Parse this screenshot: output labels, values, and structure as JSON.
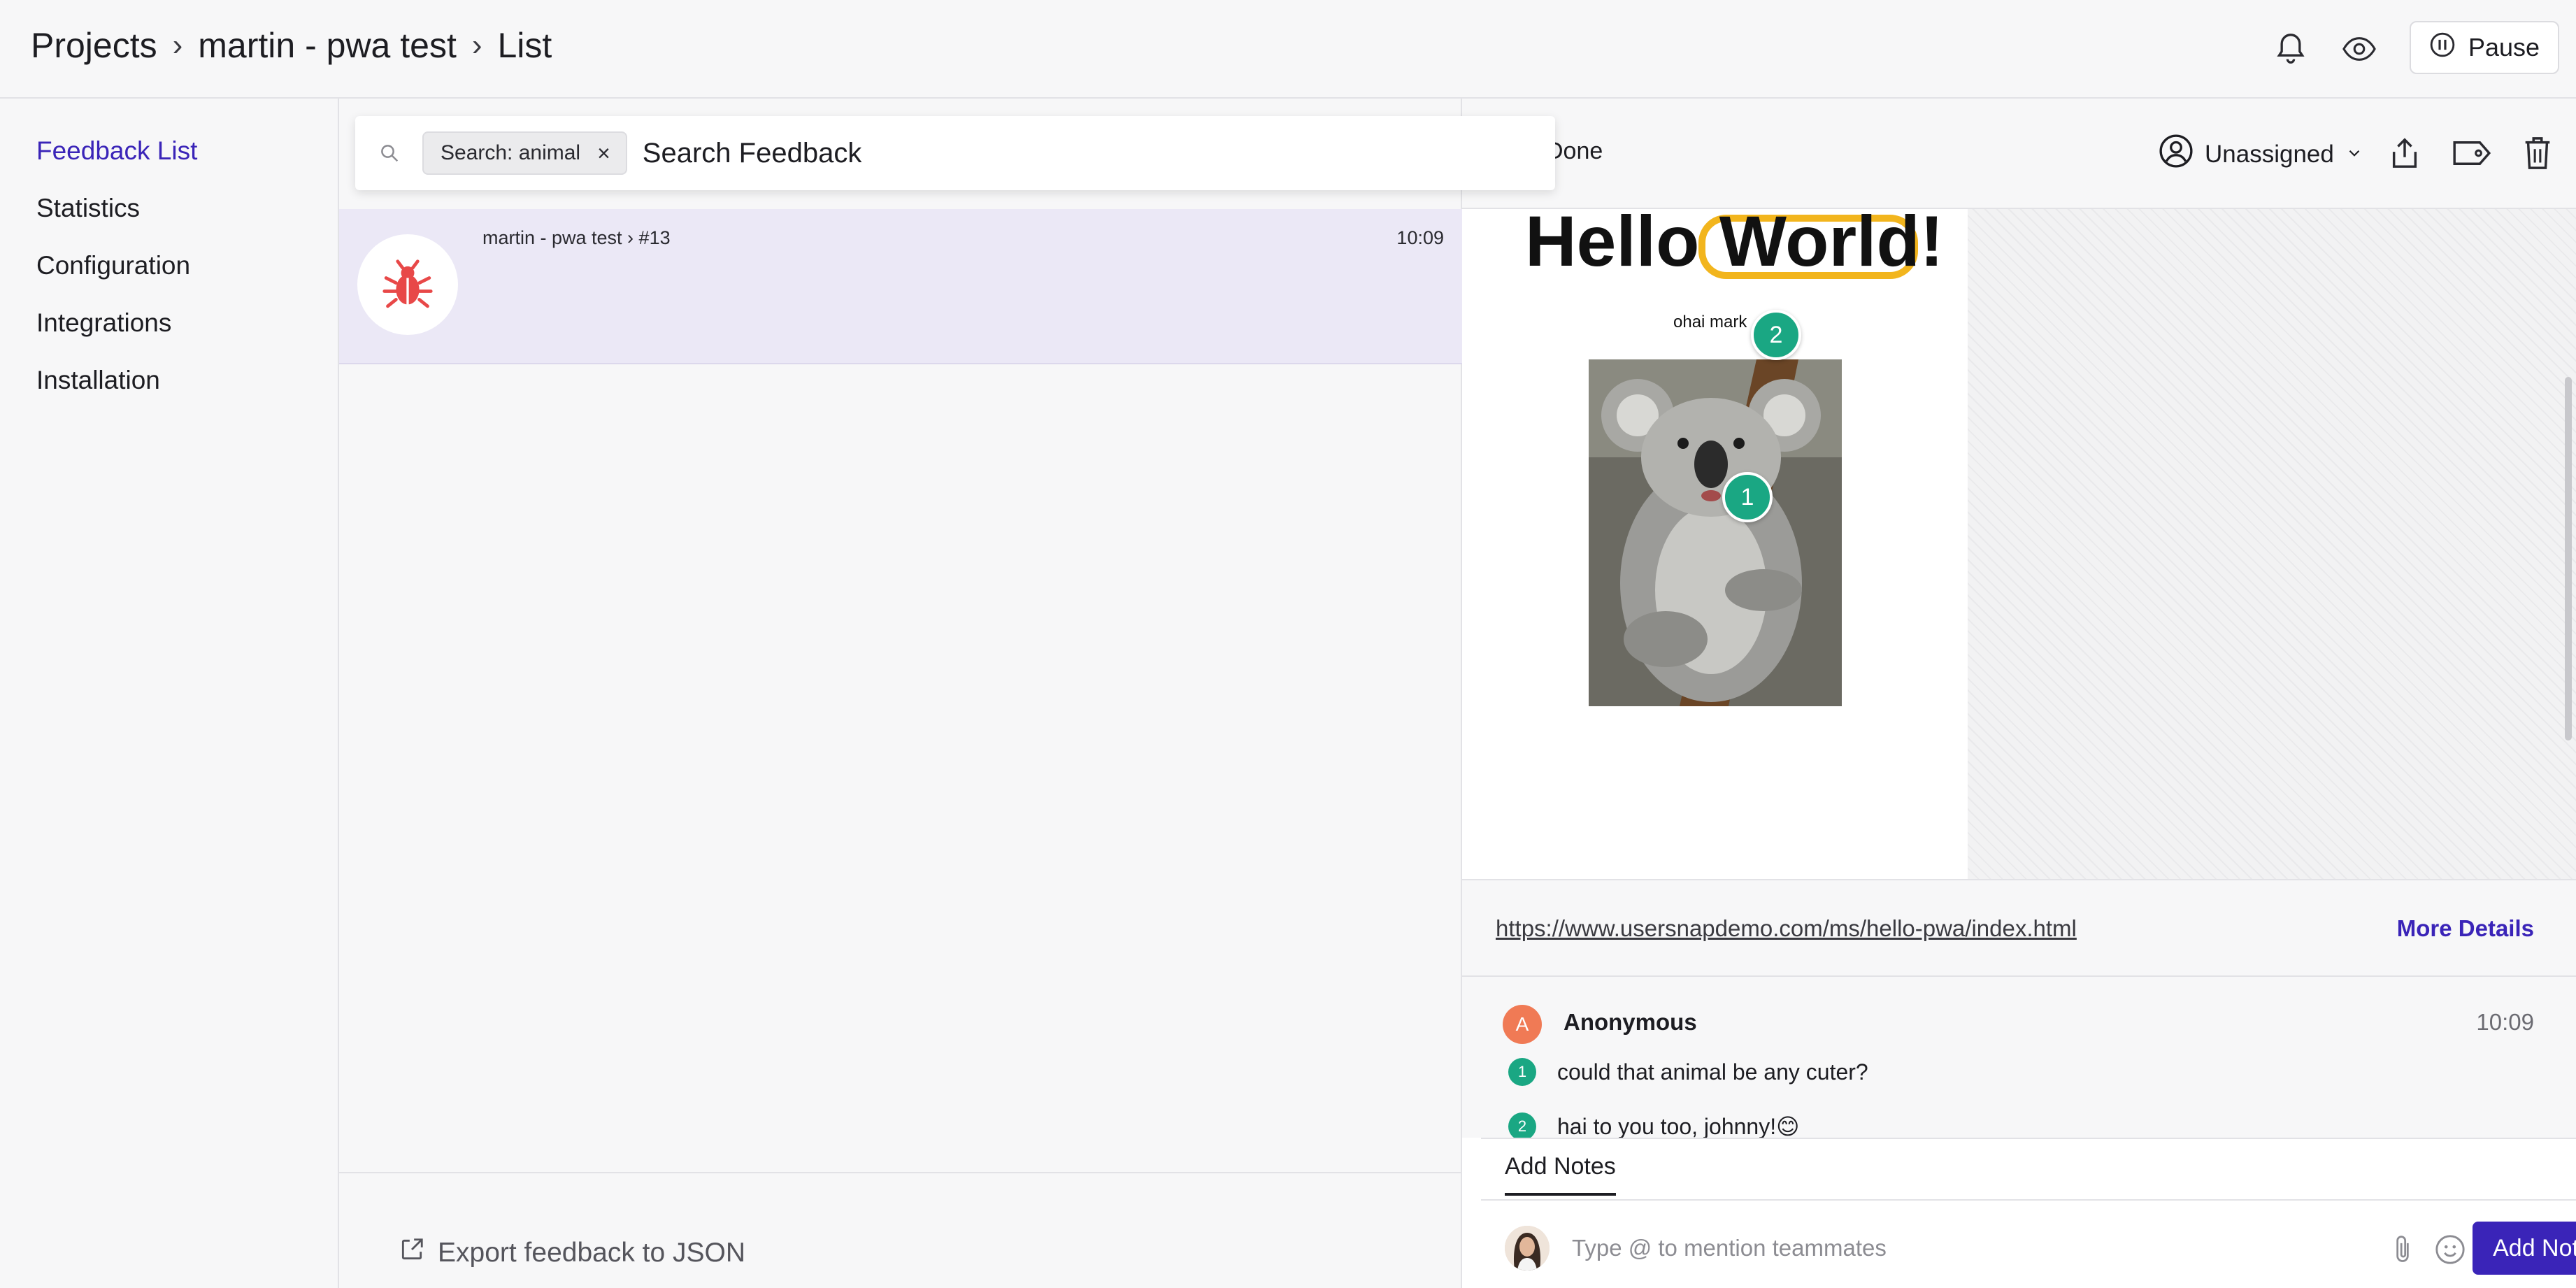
{
  "header": {
    "breadcrumb": [
      "Projects",
      "martin - pwa test",
      "List"
    ],
    "pause_label": "Pause",
    "icons": [
      "bell-icon",
      "eye-icon",
      "pause-icon"
    ]
  },
  "sidebar": {
    "items": [
      {
        "label": "Feedback List",
        "active": true
      },
      {
        "label": "Statistics",
        "active": false
      },
      {
        "label": "Configuration",
        "active": false
      },
      {
        "label": "Integrations",
        "active": false
      },
      {
        "label": "Installation",
        "active": false
      }
    ]
  },
  "search": {
    "chip_label": "Search: animal",
    "chip_close": "×",
    "placeholder": "Search Feedback"
  },
  "list": {
    "items": [
      {
        "title": "martin - pwa test › #13",
        "time": "10:09",
        "icon": "bug-icon"
      }
    ],
    "export_label": "Export feedback to JSON"
  },
  "detail": {
    "status": "Done",
    "assignee": "Unassigned",
    "screenshot": {
      "heading_part1": "Hello ",
      "heading_part2": "World!",
      "caption": "ohai mark",
      "markers": [
        "1",
        "2"
      ]
    },
    "url": "https://www.usersnapdemo.com/ms/hello-pwa/index.html",
    "more_details": "More Details",
    "comment": {
      "avatar_letter": "A",
      "author": "Anonymous",
      "time": "10:09",
      "items": [
        {
          "num": "1",
          "text": "could that animal be any cuter?"
        },
        {
          "num": "2",
          "text": "hai to you too, johnny!😊"
        }
      ]
    },
    "notes": {
      "tab_label": "Add Notes",
      "placeholder": "Type @ to mention teammates",
      "submit_label": "Add Note"
    }
  },
  "colors": {
    "accent": "#3a24b8",
    "marker": "#1aa783",
    "selected_row": "#ebe8f6",
    "highlight": "#f2b51d",
    "bug": "#e84848"
  }
}
